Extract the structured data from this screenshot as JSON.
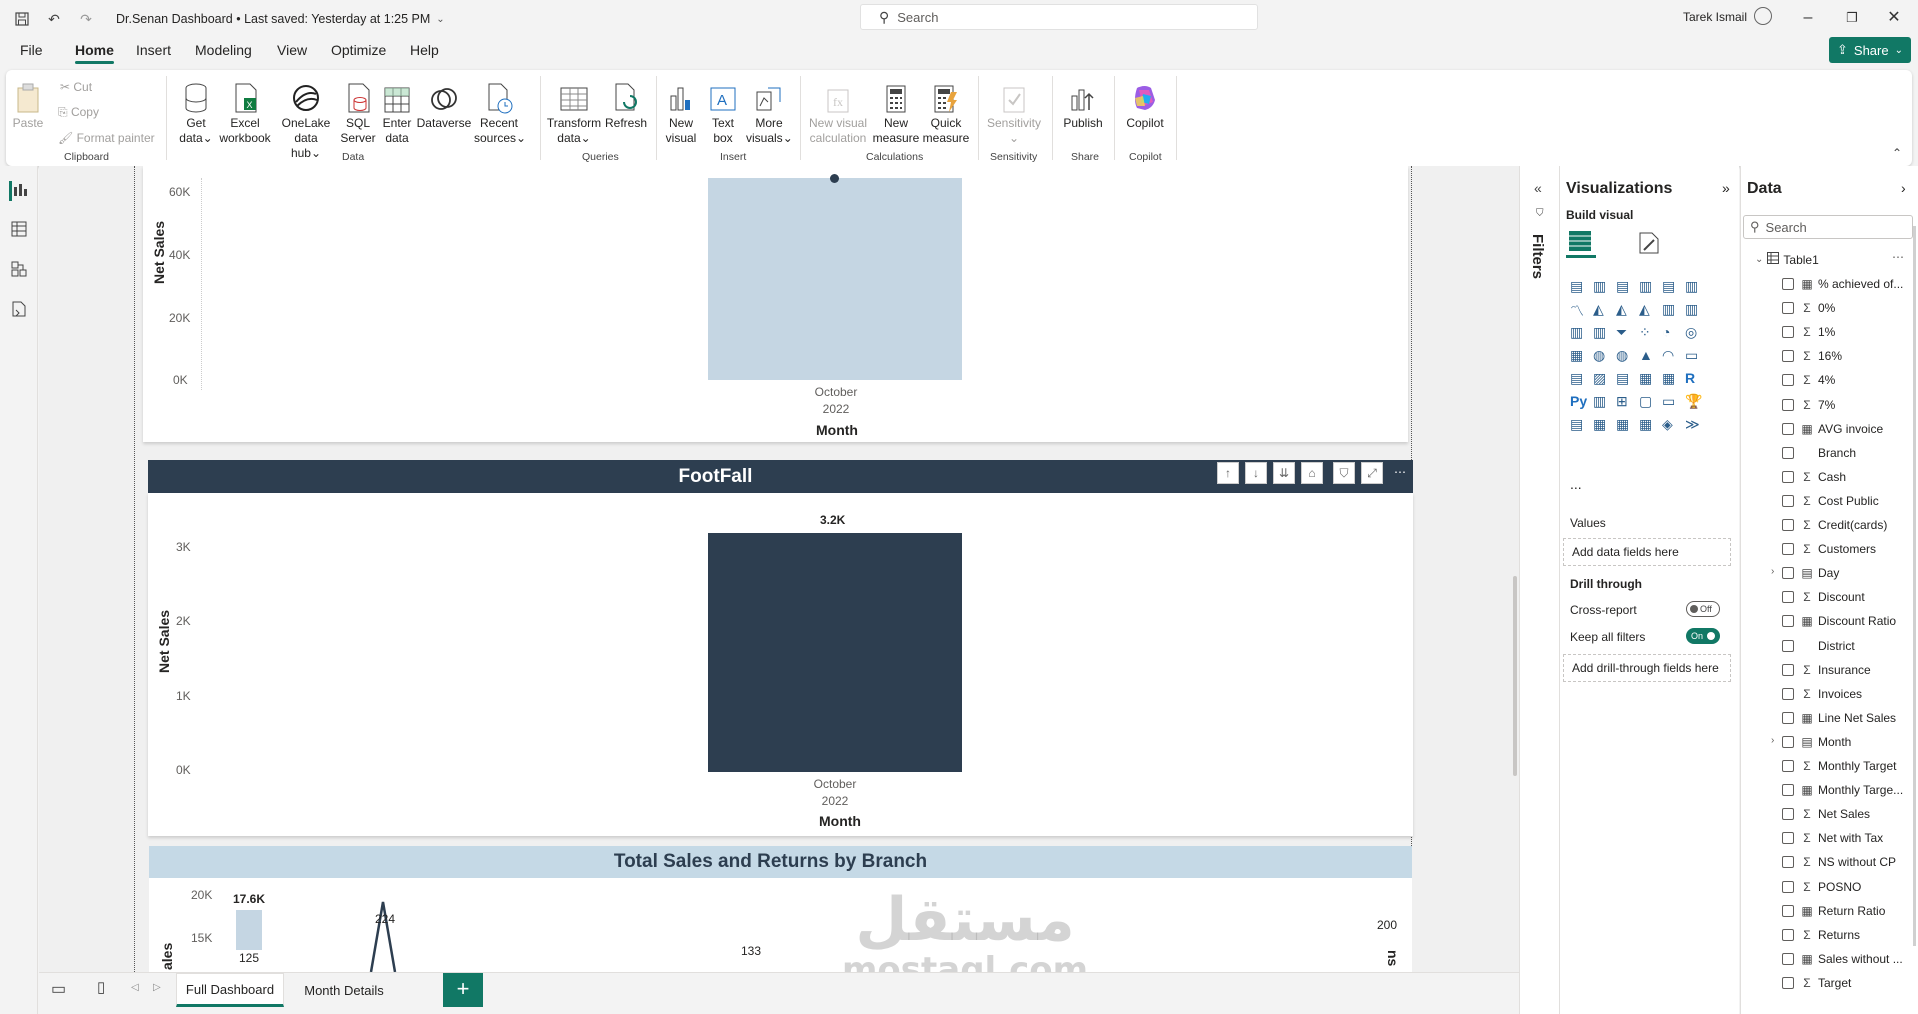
{
  "titlebar": {
    "doc_title": "Dr.Senan Dashboard • Last saved: Yesterday at 1:25 PM",
    "search_placeholder": "Search",
    "user": "Tarek Ismail",
    "icons": [
      "save-icon",
      "undo-icon",
      "redo-icon"
    ]
  },
  "menu": {
    "tabs": [
      "File",
      "Home",
      "Insert",
      "Modeling",
      "View",
      "Optimize",
      "Help"
    ],
    "share_label": "Share"
  },
  "ribbon": {
    "clipboard": {
      "paste": "Paste",
      "cut": "Cut",
      "copy": "Copy",
      "format_painter": "Format painter",
      "group": "Clipboard"
    },
    "data": {
      "get_data": [
        "Get",
        "data"
      ],
      "excel": [
        "Excel",
        "workbook"
      ],
      "onelake": [
        "OneLake",
        "data hub"
      ],
      "sql": [
        "SQL",
        "Server"
      ],
      "enter": [
        "Enter",
        "data"
      ],
      "dataverse": [
        "Dataverse",
        ""
      ],
      "recent": [
        "Recent",
        "sources"
      ],
      "group": "Data"
    },
    "queries": {
      "transform": [
        "Transform",
        "data"
      ],
      "refresh": [
        "Refresh",
        ""
      ],
      "group": "Queries"
    },
    "insert": {
      "new_visual": [
        "New",
        "visual"
      ],
      "text_box": [
        "Text",
        "box"
      ],
      "more_visuals": [
        "More",
        "visuals"
      ],
      "group": "Insert"
    },
    "calculations": {
      "new_visual_calc": [
        "New visual",
        "calculation"
      ],
      "new_measure": [
        "New",
        "measure"
      ],
      "quick_measure": [
        "Quick",
        "measure"
      ],
      "group": "Calculations"
    },
    "sensitivity": {
      "label": [
        "Sensitivity",
        ""
      ],
      "group": "Sensitivity"
    },
    "share": {
      "publish": "Publish",
      "group": "Share"
    },
    "copilot": {
      "label": "Copilot",
      "group": "Copilot"
    }
  },
  "chart_data": [
    {
      "type": "bar",
      "categories": [
        "October 2022"
      ],
      "values": [
        62000
      ],
      "xlabel": "Month",
      "ylabel": "Net Sales",
      "yticks": [
        "60K",
        "40K",
        "20K",
        "0K"
      ],
      "ylim": [
        0,
        62000
      ],
      "bar_color": "#c5d6e3"
    },
    {
      "type": "bar",
      "title": "FootFall",
      "categories": [
        "October 2022"
      ],
      "values": [
        3200
      ],
      "data_labels": [
        "3.2K"
      ],
      "xlabel": "Month",
      "ylabel": "Net Sales",
      "yticks": [
        "3K",
        "2K",
        "1K",
        "0K"
      ],
      "ylim": [
        0,
        3200
      ],
      "bar_color": "#2d3e50"
    },
    {
      "type": "bar",
      "title": "Total Sales and Returns by Branch",
      "yticks": [
        "20K",
        "15K"
      ],
      "data_labels": [
        "17.6K",
        "224",
        "125",
        "133",
        "200"
      ],
      "ylabel_partial": "ales",
      "y2label_partial": "ns"
    }
  ],
  "month_tick_line1": "October",
  "month_tick_line2": "2022",
  "footfall_header_buttons": [
    "↑",
    "↓",
    "⇊",
    "⌂",
    "⛉",
    "⤢",
    "⋯"
  ],
  "pages": {
    "tabs": [
      "Full Dashboard",
      "Month Details"
    ],
    "active": "Full Dashboard",
    "add": "+"
  },
  "filters": {
    "label": "Filters"
  },
  "visualizations": {
    "title": "Visualizations",
    "build_visual": "Build visual",
    "values_label": "Values",
    "values_well": "Add data fields here",
    "drill_through": "Drill through",
    "cross_report": "Cross-report",
    "cross_report_state": "Off",
    "keep_all_filters": "Keep all filters",
    "keep_state": "On",
    "drill_well": "Add drill-through fields here",
    "more": "..."
  },
  "data_pane": {
    "title": "Data",
    "search_placeholder": "Search",
    "table": "Table1",
    "fields": [
      {
        "name": "% achieved of...",
        "icon": "calc"
      },
      {
        "name": "0%",
        "icon": "sigma"
      },
      {
        "name": "1%",
        "icon": "sigma"
      },
      {
        "name": "16%",
        "icon": "sigma"
      },
      {
        "name": "4%",
        "icon": "sigma"
      },
      {
        "name": "7%",
        "icon": "sigma"
      },
      {
        "name": "AVG invoice",
        "icon": "calc"
      },
      {
        "name": "Branch",
        "icon": "none"
      },
      {
        "name": "Cash",
        "icon": "sigma"
      },
      {
        "name": "Cost Public",
        "icon": "sigma"
      },
      {
        "name": "Credit(cards)",
        "icon": "sigma"
      },
      {
        "name": "Customers",
        "icon": "sigma"
      },
      {
        "name": "Day",
        "icon": "calendar"
      },
      {
        "name": "Discount",
        "icon": "sigma"
      },
      {
        "name": "Discount Ratio",
        "icon": "calc"
      },
      {
        "name": "District",
        "icon": "none"
      },
      {
        "name": "Insurance",
        "icon": "sigma"
      },
      {
        "name": "Invoices",
        "icon": "sigma"
      },
      {
        "name": "Line Net Sales",
        "icon": "calc"
      },
      {
        "name": "Month",
        "icon": "calendar"
      },
      {
        "name": "Monthly Target",
        "icon": "sigma"
      },
      {
        "name": "Monthly Targe...",
        "icon": "calc"
      },
      {
        "name": "Net Sales",
        "icon": "sigma"
      },
      {
        "name": "Net with Tax",
        "icon": "sigma"
      },
      {
        "name": "NS without CP",
        "icon": "sigma"
      },
      {
        "name": "POSNO",
        "icon": "sigma"
      },
      {
        "name": "Return Ratio",
        "icon": "calc"
      },
      {
        "name": "Returns",
        "icon": "sigma"
      },
      {
        "name": "Sales without ...",
        "icon": "calc"
      },
      {
        "name": "Target",
        "icon": "sigma"
      }
    ]
  },
  "watermark": {
    "arabic": "مستقل",
    "latin": "mostaql.com"
  },
  "colors": {
    "accent": "#117865",
    "footfall_header": "#2d3e50",
    "sales_header": "#c5d9e6"
  }
}
